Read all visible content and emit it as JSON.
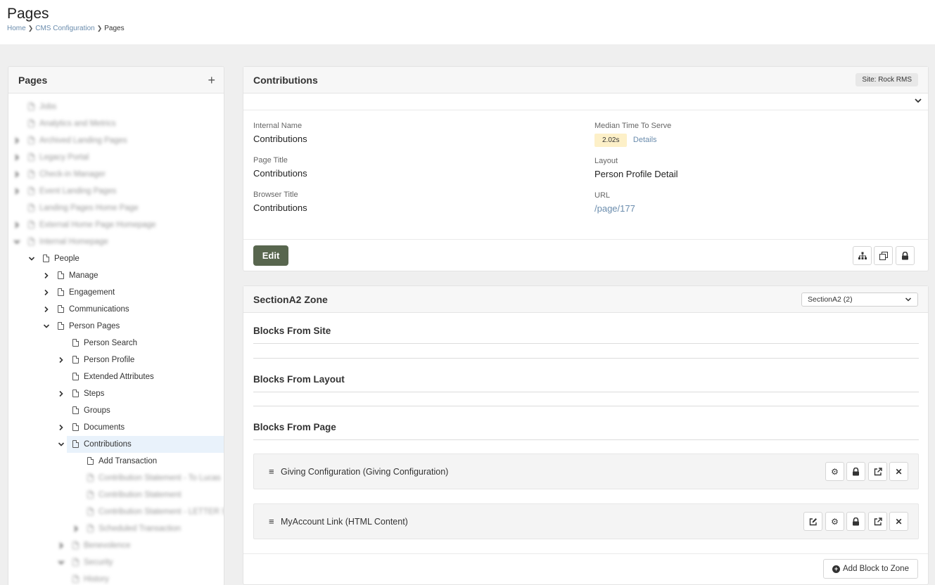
{
  "header": {
    "title": "Pages",
    "breadcrumb": [
      {
        "label": "Home"
      },
      {
        "label": "CMS Configuration"
      },
      {
        "label": "Pages"
      }
    ],
    "separator": "❯"
  },
  "tree": {
    "title": "Pages",
    "add_icon": "plus-icon",
    "items": [
      {
        "label": "Jobs",
        "depth": 0,
        "expander": "none",
        "blurred": true
      },
      {
        "label": "Analytics and Metrics",
        "depth": 0,
        "expander": "none",
        "blurred": true
      },
      {
        "label": "Archived Landing Pages",
        "depth": 0,
        "expander": "right",
        "blurred": true
      },
      {
        "label": "Legacy Portal",
        "depth": 0,
        "expander": "right",
        "blurred": true
      },
      {
        "label": "Check-in Manager",
        "depth": 0,
        "expander": "right",
        "blurred": true
      },
      {
        "label": "Event Landing Pages",
        "depth": 0,
        "expander": "right",
        "blurred": true
      },
      {
        "label": "Landing Pages Home Page",
        "depth": 0,
        "expander": "none",
        "blurred": true
      },
      {
        "label": "External Home Page Homepage",
        "depth": 0,
        "expander": "right",
        "blurred": true
      },
      {
        "label": "Internal Homepage",
        "depth": 0,
        "expander": "down",
        "blurred": true
      },
      {
        "label": "People",
        "depth": 1,
        "expander": "down",
        "blurred": false
      },
      {
        "label": "Manage",
        "depth": 2,
        "expander": "right",
        "blurred": false
      },
      {
        "label": "Engagement",
        "depth": 2,
        "expander": "right",
        "blurred": false
      },
      {
        "label": "Communications",
        "depth": 2,
        "expander": "right",
        "blurred": false
      },
      {
        "label": "Person Pages",
        "depth": 2,
        "expander": "down",
        "blurred": false
      },
      {
        "label": "Person Search",
        "depth": 3,
        "expander": "none",
        "blurred": false
      },
      {
        "label": "Person Profile",
        "depth": 3,
        "expander": "right",
        "blurred": false
      },
      {
        "label": "Extended Attributes",
        "depth": 3,
        "expander": "none",
        "blurred": false
      },
      {
        "label": "Steps",
        "depth": 3,
        "expander": "right",
        "blurred": false
      },
      {
        "label": "Groups",
        "depth": 3,
        "expander": "none",
        "blurred": false
      },
      {
        "label": "Documents",
        "depth": 3,
        "expander": "right",
        "blurred": false
      },
      {
        "label": "Contributions",
        "depth": 3,
        "expander": "down",
        "blurred": false,
        "selected": true
      },
      {
        "label": "Add Transaction",
        "depth": 4,
        "expander": "none",
        "blurred": false
      },
      {
        "label": "Contribution Statement - To Lucas",
        "depth": 4,
        "expander": "none",
        "blurred": true
      },
      {
        "label": "Contribution Statement",
        "depth": 4,
        "expander": "none",
        "blurred": true
      },
      {
        "label": "Contribution Statement - LETTER STYLE",
        "depth": 4,
        "expander": "none",
        "blurred": true
      },
      {
        "label": "Scheduled Transaction",
        "depth": 4,
        "expander": "right",
        "blurred": true
      },
      {
        "label": "Benevolence",
        "depth": 3,
        "expander": "right",
        "blurred": true
      },
      {
        "label": "Security",
        "depth": 3,
        "expander": "down",
        "blurred": true
      },
      {
        "label": "History",
        "depth": 3,
        "expander": "none",
        "blurred": true
      }
    ]
  },
  "page_detail": {
    "title": "Contributions",
    "site_badge": "Site: Rock RMS",
    "internal_name_label": "Internal Name",
    "internal_name": "Contributions",
    "page_title_label": "Page Title",
    "page_title": "Contributions",
    "browser_title_label": "Browser Title",
    "browser_title": "Contributions",
    "median_label": "Median Time To Serve",
    "median_value": "2.02s",
    "details_link": "Details",
    "layout_label": "Layout",
    "layout_value": "Person Profile Detail",
    "url_label": "URL",
    "url_value": "/page/177",
    "edit_button": "Edit"
  },
  "zone": {
    "title": "SectionA2 Zone",
    "select_value": "SectionA2 (2)",
    "blocks_from_site": "Blocks From Site",
    "blocks_from_layout": "Blocks From Layout",
    "blocks_from_page": "Blocks From Page",
    "blocks": [
      {
        "name": "Giving Configuration (Giving Configuration)"
      },
      {
        "name": "MyAccount Link (HTML Content)"
      }
    ],
    "add_block_button": "Add Block to Zone"
  },
  "colors": {
    "edit_button": "#58664e",
    "link": "#6a8cad",
    "time_badge": "#fdf0c8",
    "selected_row": "#e9f2fb"
  }
}
